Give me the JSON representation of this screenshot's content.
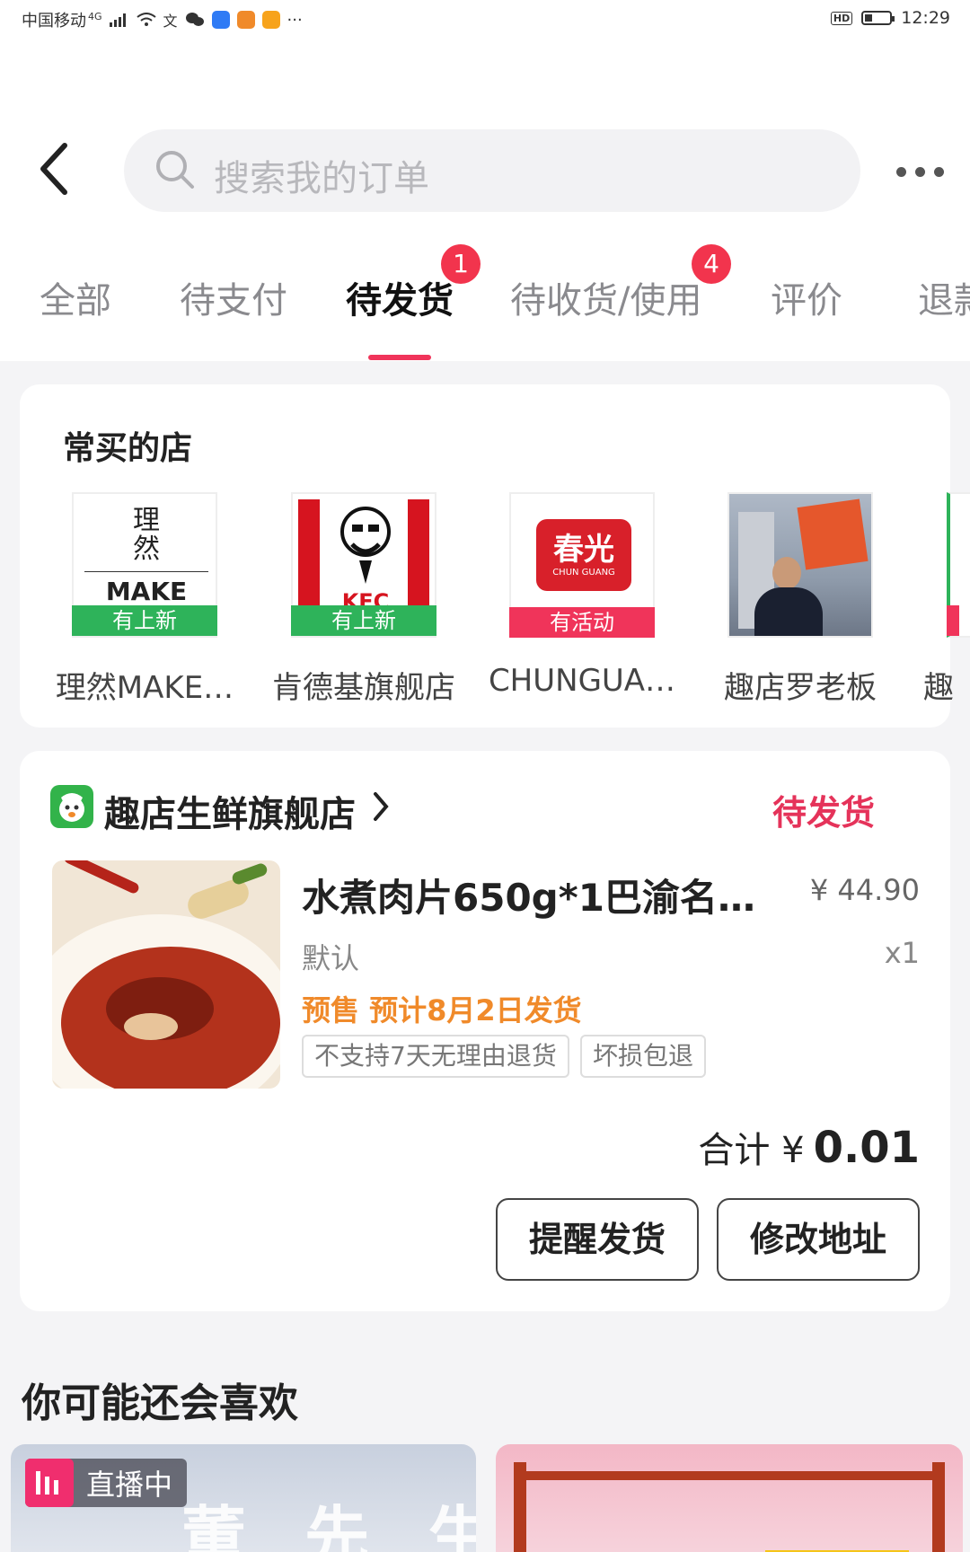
{
  "status_bar": {
    "carrier": "中国移动",
    "network": "4G",
    "time": "12:29",
    "hd": "HD"
  },
  "search": {
    "placeholder": "搜索我的订单"
  },
  "tabs": [
    {
      "label": "全部",
      "badge": ""
    },
    {
      "label": "待支付",
      "badge": ""
    },
    {
      "label": "待发货",
      "badge": "1"
    },
    {
      "label": "待收货/使用",
      "badge": "4"
    },
    {
      "label": "评价",
      "badge": ""
    },
    {
      "label": "退款",
      "badge": ""
    }
  ],
  "frequent_shops": {
    "title": "常买的店",
    "shops": [
      {
        "name": "理然MAKE…",
        "tag": "有上新",
        "logo_text_1": "理",
        "logo_text_2": "然",
        "logo_text_3": "MAKE"
      },
      {
        "name": "肯德基旗舰店",
        "tag": "有上新",
        "logo_text": "KFC"
      },
      {
        "name": "CHUNGUA…",
        "tag": "有活动",
        "logo_text": "春光",
        "logo_sub": "CHUN GUANG"
      },
      {
        "name": "趣店罗老板",
        "tag": "",
        "logo_text": ""
      },
      {
        "name": "趣",
        "tag": "",
        "logo_text": ""
      }
    ]
  },
  "order": {
    "store_name": "趣店生鲜旗舰店",
    "status": "待发货",
    "product_title": "水煮肉片650g*1巴渝名菜…",
    "price": "¥ 44.90",
    "variant": "默认",
    "quantity": "x1",
    "presale": "预售 预计8月2日发货",
    "tags": [
      "不支持7天无理由退货",
      "坏损包退"
    ],
    "total_label": "合计 ¥",
    "total_amount": "0.01",
    "buttons": {
      "remind": "提醒发货",
      "change_address": "修改地址"
    }
  },
  "recommend": {
    "title": "你可能还会喜欢",
    "live_label": "直播中",
    "card1_text": "董 先 生"
  },
  "colors": {
    "accent_red": "#f0345a",
    "badge_red": "#f2344d",
    "tag_green": "#2eb35a",
    "tag_red": "#f0345a",
    "presale_orange": "#f08a2a"
  }
}
